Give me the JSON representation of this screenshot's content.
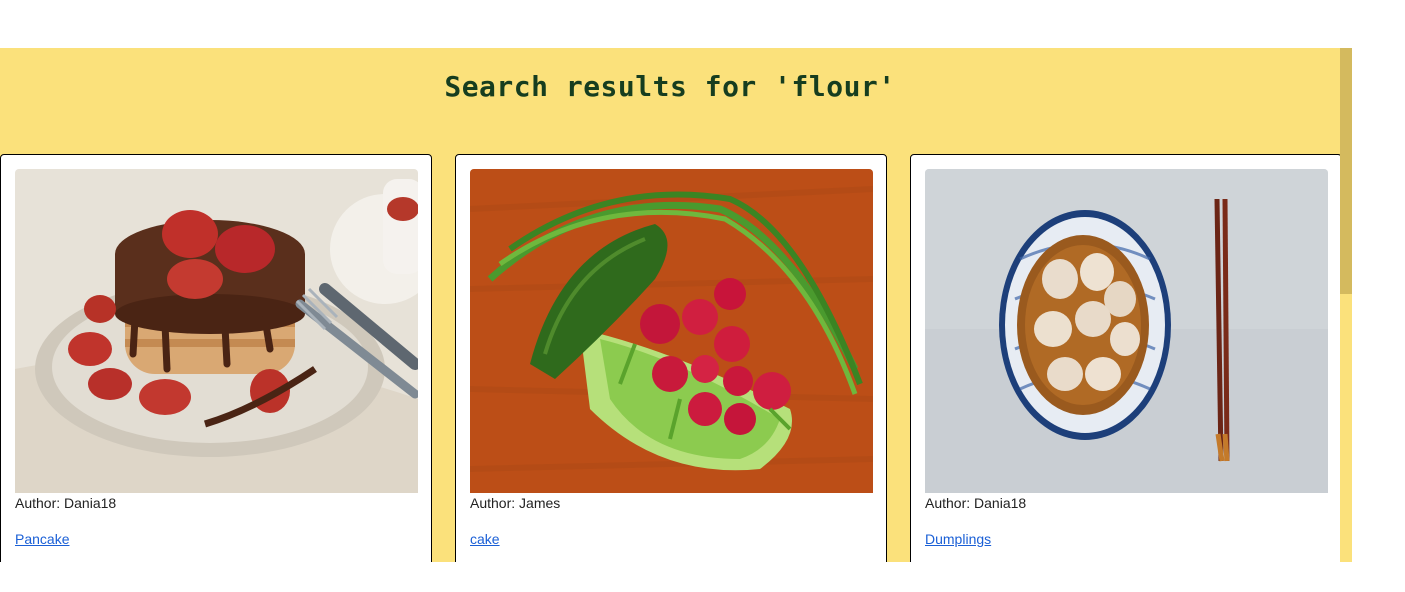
{
  "page": {
    "title": "Search results for 'flour'"
  },
  "colors": {
    "banner_background": "#fbe17b",
    "title_color": "#163d1f",
    "link_color": "#1a5fd6"
  },
  "results": [
    {
      "image_name": "pancake-photo",
      "author_label": "Author: Dania18",
      "link_label": "Pancake"
    },
    {
      "image_name": "vegetables-photo",
      "author_label": "Author: James",
      "link_label": "cake"
    },
    {
      "image_name": "dumplings-photo",
      "author_label": "Author: Dania18",
      "link_label": "Dumplings"
    }
  ]
}
